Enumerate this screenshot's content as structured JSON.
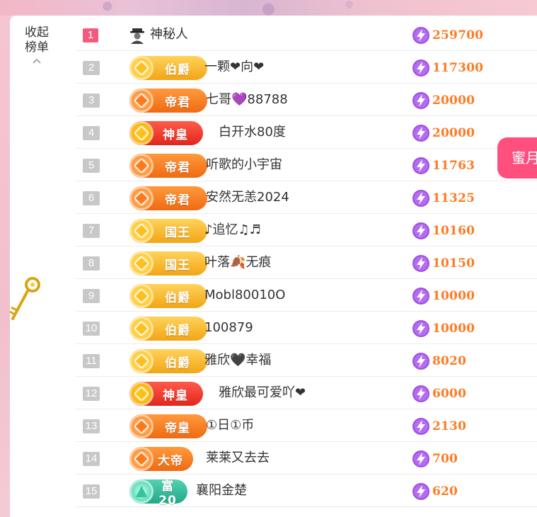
{
  "collapse": {
    "line1": "收起",
    "line2": "榜单"
  },
  "side_button": {
    "label": "蜜月"
  },
  "colors": {
    "score": "#ff7a22",
    "first_rank": "#f25b7c",
    "side_button": "#ff4f7e"
  },
  "rows": [
    {
      "rank": "1",
      "badge": null,
      "icon": "mystery-person-icon",
      "name": "神秘人",
      "score": "259700"
    },
    {
      "rank": "2",
      "badge": "伯爵",
      "name": "一颗❤向❤",
      "score": "117300"
    },
    {
      "rank": "3",
      "badge": "帝君",
      "name": "七哥💜88788",
      "score": "20000"
    },
    {
      "rank": "4",
      "badge": "神皇",
      "name": "白开水80度",
      "score": "20000"
    },
    {
      "rank": "5",
      "badge": "帝君",
      "name": "听歌的小宇宙",
      "score": "11763"
    },
    {
      "rank": "6",
      "badge": "帝君",
      "name": "安然无恙2024",
      "score": "11325"
    },
    {
      "rank": "7",
      "badge": "国王",
      "name": "♪追忆♫♬",
      "score": "10160"
    },
    {
      "rank": "8",
      "badge": "国王",
      "name": "叶落🍂无痕",
      "score": "10150"
    },
    {
      "rank": "9",
      "badge": "伯爵",
      "name": "Mobl80010O",
      "score": "10000"
    },
    {
      "rank": "10",
      "badge": "伯爵",
      "name": "100879",
      "score": "10000"
    },
    {
      "rank": "11",
      "badge": "伯爵",
      "name": "雅欣🖤幸福",
      "score": "8020"
    },
    {
      "rank": "12",
      "badge": "神皇",
      "name": "雅欣最可爱吖❤",
      "score": "6000"
    },
    {
      "rank": "13",
      "badge": "帝皇",
      "name": "①日①币",
      "score": "2130"
    },
    {
      "rank": "14",
      "badge": "大帝",
      "name": "莱莱又去去",
      "score": "700"
    },
    {
      "rank": "15",
      "badge": "富20",
      "name": "襄阳金楚",
      "score": "620"
    }
  ]
}
